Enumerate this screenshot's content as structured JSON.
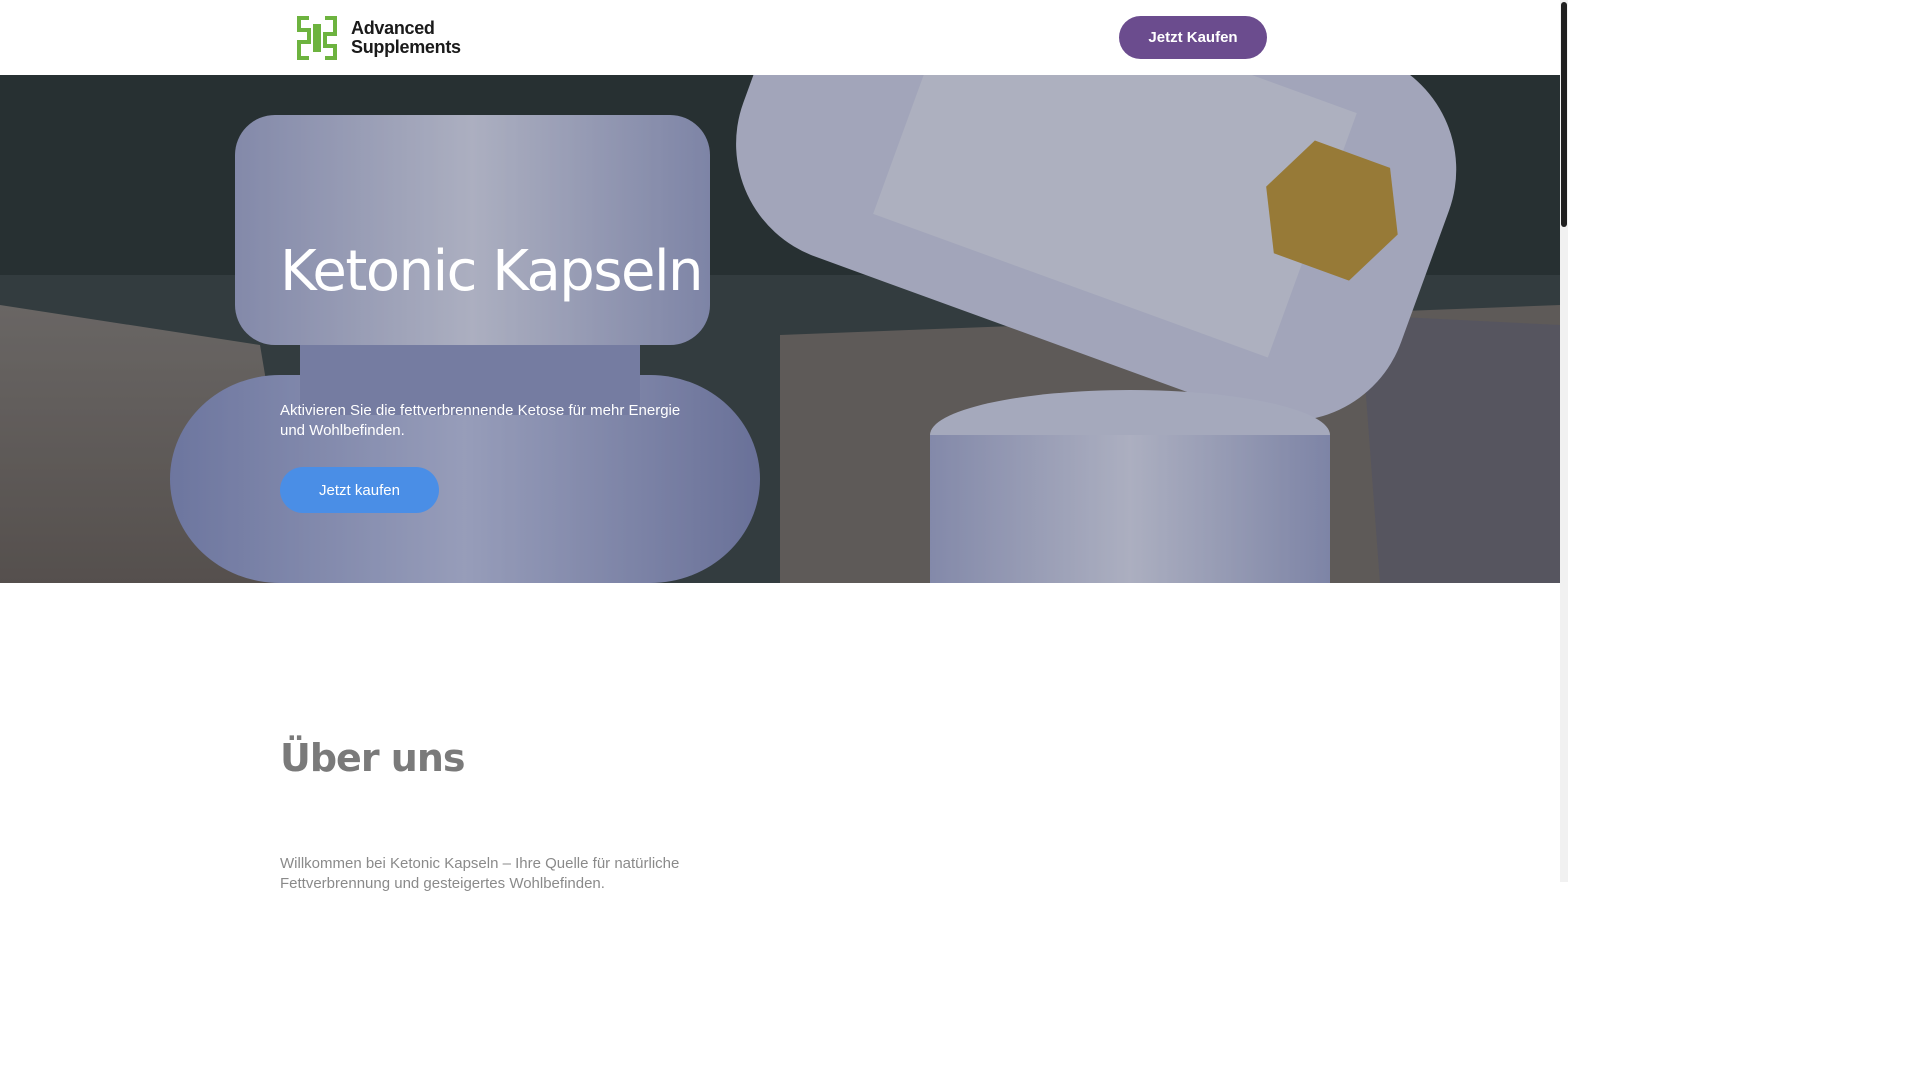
{
  "header": {
    "logo_line1": "Advanced",
    "logo_line2": "Supplements",
    "cta_label": "Jetzt Kaufen"
  },
  "hero": {
    "title": "Ketonic Kapseln",
    "subtitle": "Aktivieren Sie die fettverbrennende Ketose für mehr Energie und Wohlbefinden.",
    "cta_label": "Jetzt kaufen"
  },
  "about": {
    "title": "Über uns",
    "text": "Willkommen bei Ketonic Kapseln – Ihre Quelle für natürliche Fettverbrennung und gesteigertes Wohlbefinden."
  },
  "colors": {
    "brand_purple": "#6b4c8e",
    "accent_blue": "#4a8ee6",
    "logo_green": "#6db33f"
  }
}
